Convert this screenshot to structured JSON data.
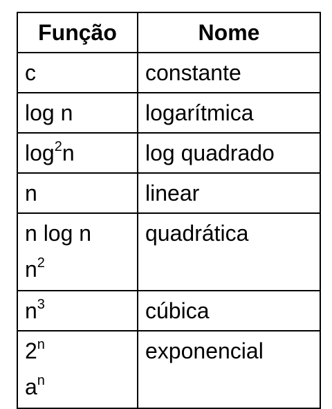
{
  "table": {
    "headers": [
      "Função",
      "Nome"
    ],
    "rows": [
      {
        "funcao": [
          {
            "base": "c"
          }
        ],
        "nome": "constante"
      },
      {
        "funcao": [
          {
            "base": "log n"
          }
        ],
        "nome": "logarítmica"
      },
      {
        "funcao": [
          {
            "base": "log",
            "sup": "2",
            "after": "n"
          }
        ],
        "nome": "log quadrado"
      },
      {
        "funcao": [
          {
            "base": "n"
          }
        ],
        "nome": "linear"
      },
      {
        "funcao": [
          {
            "base": "n log n"
          },
          {
            "base": "n",
            "sup": "2"
          }
        ],
        "nome": "quadrática"
      },
      {
        "funcao": [
          {
            "base": "n",
            "sup": "3"
          }
        ],
        "nome": "cúbica"
      },
      {
        "funcao": [
          {
            "base": "2",
            "sup": "n"
          },
          {
            "base": "a",
            "sup": "n"
          }
        ],
        "nome": "exponencial"
      }
    ]
  }
}
